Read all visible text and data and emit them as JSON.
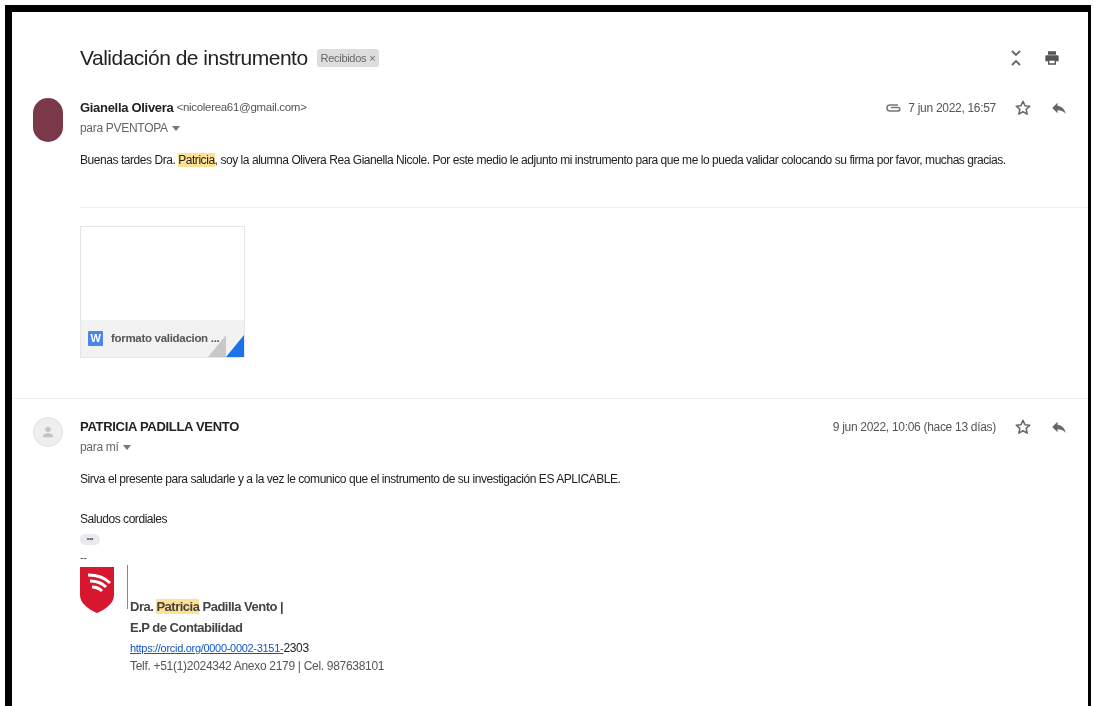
{
  "subject": {
    "title": "Validación de instrumento",
    "label": "Recibidos",
    "label_close": "×"
  },
  "messages": [
    {
      "sender": "Gianella Olivera",
      "email": "<nicolerea61@gmail.com>",
      "to": "para PVENTOPA",
      "has_attachment": true,
      "date": "7 jun 2022, 16:57",
      "starred": false,
      "kind": "photo",
      "body": [
        [
          {
            "text": "Buenas tardes Dra. ",
            "highlighted": false
          },
          {
            "text": "Patricia",
            "highlighted": true
          },
          {
            "text": ", soy la alumna Olivera Rea Gianella Nicole. Por este medio le adjunto mi instrumento para que me lo pueda validar colocando su firma por favor, muchas gracias.",
            "highlighted": false
          }
        ]
      ],
      "attachments": [
        {
          "icon_letter": "W",
          "name": "formato validacion ..."
        }
      ]
    },
    {
      "sender": "PATRICIA PADILLA VENTO",
      "to": "para mí",
      "has_attachment": false,
      "date": "9 jun 2022, 10:06 (hace 13 días)",
      "starred": false,
      "kind": "generic",
      "body": [
        [
          {
            "text": "Sirva el presente para saludarle y a la vez le comunico que el instrumento de su investigación ES APLICABLE.",
            "highlighted": false
          }
        ],
        [
          {
            "text": "Saludos cordiales",
            "highlighted": false
          }
        ]
      ],
      "trimmed_marker": "•••",
      "signature": {
        "separator": "--",
        "name": [
          {
            "text": "Dra. ",
            "highlighted": false
          },
          {
            "text": "Patricia",
            "highlighted": true
          },
          {
            "text": " Padilla Vento |",
            "highlighted": false
          }
        ],
        "department": "E.P de Contabilidad",
        "link": "https://orcid.org/0000-0002-3151-",
        "link_suffix": "2303",
        "contact": "Telf. +51(1)2024342 Anexo 2179 | Cel. 987638101"
      }
    }
  ]
}
